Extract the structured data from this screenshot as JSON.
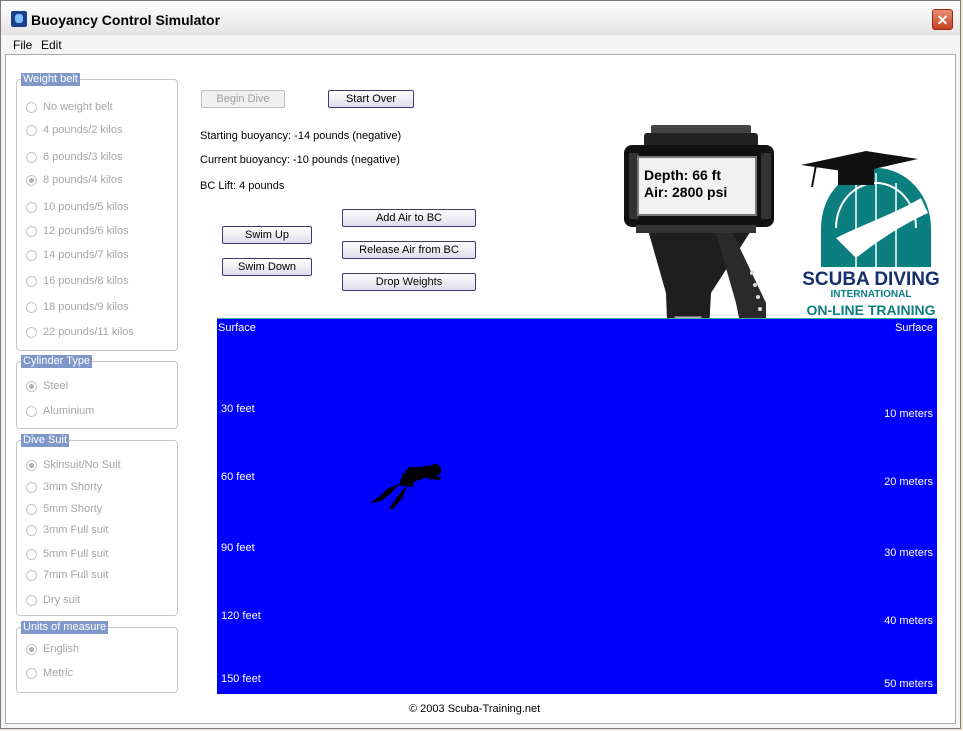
{
  "window": {
    "title": "Buoyancy Control Simulator",
    "close_glyph": "✕"
  },
  "menu": [
    "File",
    "Edit"
  ],
  "weight_belt": {
    "title": "Weight belt",
    "options": [
      "No weight belt",
      "4 pounds/2 kilos",
      "6 pounds/3 kilos",
      "8 pounds/4 kilos",
      "10 pounds/5 kilos",
      "12 pounds/6 kilos",
      "14 pounds/7 kilos",
      "16 pounds/8 kilos",
      "18 pounds/9 kilos",
      "22 pounds/11 kilos"
    ],
    "selected": "8 pounds/4 kilos"
  },
  "cylinder_type": {
    "title": "Cylinder Type",
    "options": [
      "Steel",
      "Aluminium"
    ],
    "selected": "Steel"
  },
  "dive_suit": {
    "title": "Dive Suit",
    "options": [
      "Skinsuit/No Suit",
      "3mm Shorty",
      "5mm Shorty",
      "3mm Full suit",
      "5mm Full suit",
      "7mm Full suit",
      "Dry suit"
    ],
    "selected": "Skinsuit/No Suit"
  },
  "units": {
    "title": "Units of measure",
    "options": [
      "English",
      "Metric"
    ],
    "selected": "English"
  },
  "buttons": {
    "begin_dive": "Begin Dive",
    "start_over": "Start Over",
    "swim_up": "Swim Up",
    "swim_down": "Swim Down",
    "add_air": "Add Air to BC",
    "release_air": "Release Air from BC",
    "drop_weights": "Drop Weights"
  },
  "status": {
    "starting_buoyancy": "Starting buoyancy: -14 pounds (negative)",
    "current_buoyancy": "Current buoyancy: -10 pounds (negative)",
    "bc_lift": "BC Lift: 4 pounds"
  },
  "computer": {
    "depth": "Depth: 66 ft",
    "air": "Air: 2800 psi"
  },
  "logo": {
    "line1": "SCUBA DIVING",
    "line2": "INTERNATIONAL",
    "line3": "ON-LINE TRAINING"
  },
  "water": {
    "left_labels": [
      "Surface",
      "30 feet",
      "60 feet",
      "90 feet",
      "120 feet",
      "150 feet"
    ],
    "right_labels": [
      "Surface",
      "10 meters",
      "20 meters",
      "30 meters",
      "40 meters",
      "50 meters"
    ],
    "diver_depth_ft": 66
  },
  "colors": {
    "water": "#0000ff",
    "legend_bg": "#7f97c9",
    "logo_teal": "#0b7f7f",
    "logo_navy": "#15306b"
  },
  "copyright": "© 2003 Scuba-Training.net"
}
